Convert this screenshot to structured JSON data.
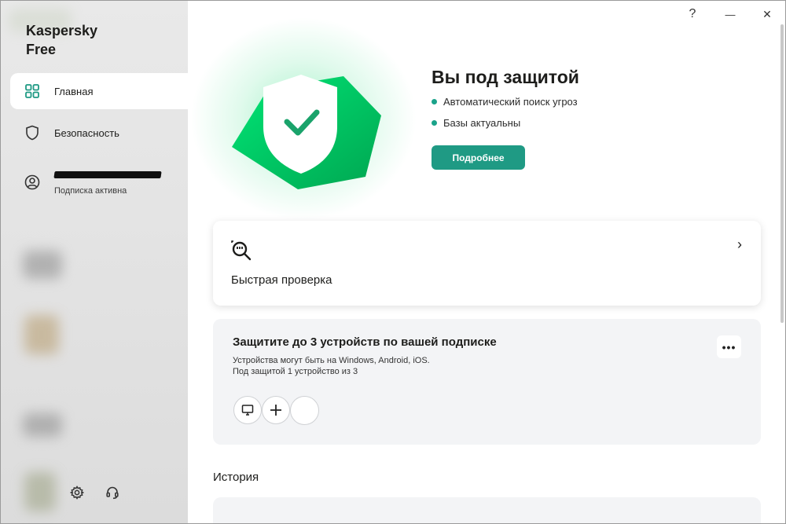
{
  "app": {
    "brand_line1": "Kaspersky",
    "brand_line2": "Free"
  },
  "sidebar": {
    "items": [
      {
        "label": "Главная",
        "icon": "dashboard-icon",
        "active": true
      },
      {
        "label": "Безопасность",
        "icon": "shield-icon",
        "active": false
      }
    ],
    "account": {
      "icon": "user-icon",
      "subtitle": "Подписка активна"
    },
    "bottom_icons": [
      "gear-icon",
      "headset-icon"
    ]
  },
  "window_controls": {
    "help": "?",
    "minimize": "—",
    "close": "✕"
  },
  "status": {
    "title": "Вы под защитой",
    "lines": [
      "Автоматический поиск угроз",
      "Базы актуальны"
    ],
    "button": "Подробнее",
    "accent_color": "#1f9a84",
    "shield_color": "#00c853"
  },
  "quick_scan": {
    "label": "Быстрая проверка",
    "icon": "scan-magnifier-icon"
  },
  "devices": {
    "title": "Защитите до 3 устройств по вашей подписке",
    "line1": "Устройства могут быть на Windows, Android, iOS.",
    "line2": "Под защитой 1 устройство из 3",
    "icons": [
      "monitor-icon",
      "plus-icon"
    ]
  },
  "history": {
    "title": "История"
  }
}
